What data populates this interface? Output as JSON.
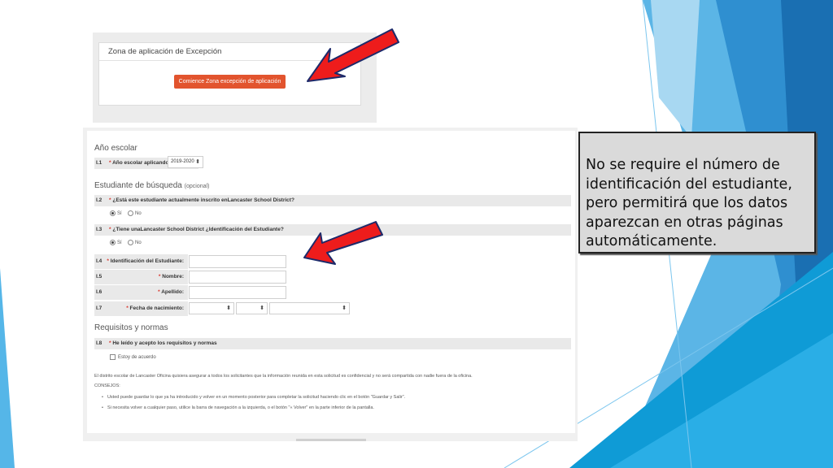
{
  "top_panel": {
    "title": "Zona de aplicación de Excepción",
    "start_button": "Comience Zona excepción de aplicación"
  },
  "form": {
    "school_year": {
      "title": "Año escolar",
      "num": "I.1",
      "label": "Año escolar aplicando:",
      "value": "2019-2020"
    },
    "student_search": {
      "title": "Estudiante de búsqueda",
      "optional": "(opcional)",
      "q2": {
        "num": "I.2",
        "label": "¿Está este estudiante actualmente inscrito enLancaster School District?"
      },
      "q3": {
        "num": "I.3",
        "label": "¿Tiene unaLancaster School District ¿Identificación del Estudiante?"
      },
      "yes": "Sí",
      "no": "No",
      "student_id": {
        "num": "I.4",
        "label": "Identificación del Estudiante:"
      },
      "first_name": {
        "num": "I.5",
        "label": "Nombre:"
      },
      "last_name": {
        "num": "I.6",
        "label": "Apellido:"
      },
      "birth_date": {
        "num": "I.7",
        "label": "Fecha de nacimiento:"
      }
    },
    "requirements": {
      "title": "Requisitos y normas",
      "num": "I.8",
      "label_prefix": "He leído y acepto los",
      "label_strong": "requisitos y normas",
      "agree": "Estoy de acuerdo"
    },
    "footer": {
      "notice": "El distrito escolar de Lancaster Oficina quisiera asegurar a todos los solicitantes que la información reunida en esta solicitud es confidencial y no será compartida con nadie fuera de la oficina.",
      "tips_title": "CONSEJOS:",
      "tips": [
        "Usted puede guardar lo que ya ha introducido y volver en un momento posterior para completar la solicitud haciendo clic en el botón \"Guardar y Salir\".",
        "Si necesita volver a cualquier paso, utilice la barra de navegación a la izquierda, o el botón \"« Volver\" en la parte inferior de la pantalla."
      ]
    }
  },
  "note": {
    "text": "No se require el número de identificación del estudiante, pero permitirá que los datos aparezcan en otras páginas automáticamente."
  },
  "colors": {
    "accent_button": "#e2542e",
    "arrow": "#ee1c1c",
    "required": "#d9342b"
  }
}
